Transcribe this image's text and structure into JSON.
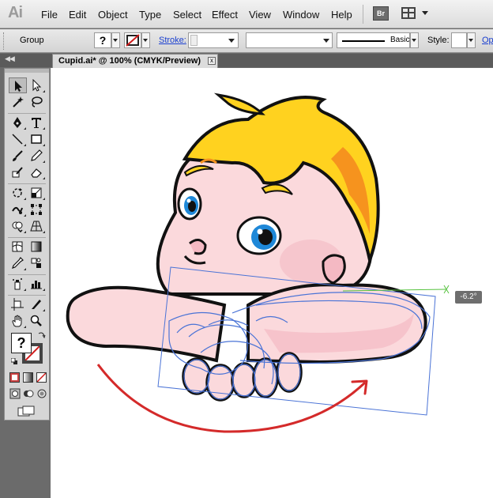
{
  "app": {
    "logo": "Ai",
    "accent": "#1a3fd0"
  },
  "menu": {
    "items": [
      "File",
      "Edit",
      "Object",
      "Type",
      "Select",
      "Effect",
      "View",
      "Window",
      "Help"
    ],
    "bridge_label": "Br"
  },
  "control_bar": {
    "selection": "Group",
    "fill_symbol": "?",
    "stroke_link": "Stroke:",
    "brush_label": "Basic",
    "style_label": "Style:",
    "opacity_link": "Op"
  },
  "document": {
    "tab_label": "Cupid.ai* @ 100% (CMYK/Preview)",
    "close_symbol": "x"
  },
  "tools": {
    "fill_symbol": "?",
    "icons": [
      "selection-tool-icon",
      "direct-selection-tool-icon",
      "magic-wand-tool-icon",
      "lasso-tool-icon",
      "pen-tool-icon",
      "type-tool-icon",
      "line-segment-tool-icon",
      "rectangle-tool-icon",
      "paintbrush-tool-icon",
      "pencil-tool-icon",
      "blob-brush-tool-icon",
      "eraser-tool-icon",
      "rotate-tool-icon",
      "scale-tool-icon",
      "warp-tool-icon",
      "free-transform-tool-icon",
      "shape-builder-tool-icon",
      "perspective-grid-tool-icon",
      "mesh-tool-icon",
      "gradient-tool-icon",
      "eyedropper-tool-icon",
      "blend-tool-icon",
      "symbol-sprayer-tool-icon",
      "column-graph-tool-icon",
      "artboard-tool-icon",
      "slice-tool-icon",
      "hand-tool-icon",
      "zoom-tool-icon"
    ]
  },
  "canvas": {
    "rotation_readout": "-6.2°",
    "colors": {
      "hair_light": "#ffd21f",
      "hair_dark": "#f6931e",
      "skin": "#fbd9dc",
      "skin_shade": "#f4b9c3",
      "eye_blue": "#1e88d8",
      "selection_blue": "#4a73d6",
      "arrow_red": "#d42a2a",
      "guide_green": "#56c23f"
    }
  }
}
